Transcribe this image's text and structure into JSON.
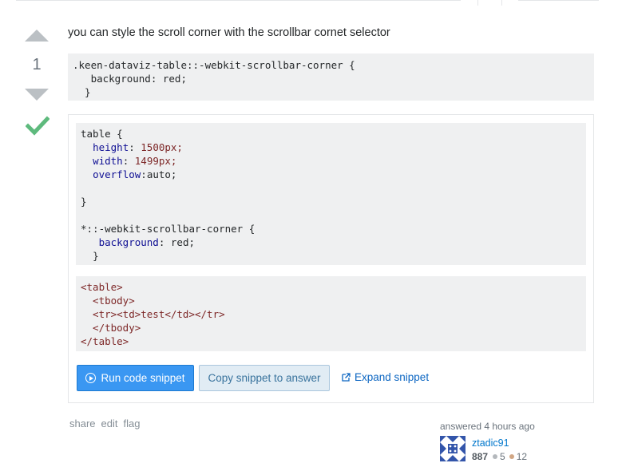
{
  "answer": {
    "vote_count": "1",
    "text": "you can style the scroll corner with the scrollbar cornet selector",
    "code1": [
      ".keen-dataviz-table::-webkit-scrollbar-corner {",
      "   background: red;",
      "  }"
    ]
  },
  "snippet": {
    "css": {
      "selector1": "table {",
      "props": [
        {
          "name": "height",
          "value": "1500px;"
        },
        {
          "name": "width",
          "value": "1499px;"
        },
        {
          "name": "overflow",
          "value": "auto;"
        }
      ],
      "close1": "}",
      "selector2": "*::-webkit-scrollbar-corner {",
      "bg_prop": "background",
      "bg_value": "red;",
      "close2": "}"
    },
    "html": [
      "<table>",
      "  <tbody>",
      "  <tr><td>test</td></tr>",
      "  </tbody>",
      "</table>"
    ],
    "run_label": "Run code snippet",
    "copy_label": "Copy snippet to answer",
    "expand_label": "Expand snippet"
  },
  "post_menu": {
    "share": "share",
    "edit": "edit",
    "flag": "flag"
  },
  "user": {
    "action": "answered 4 hours ago",
    "name": "ztadic91",
    "reputation": "887",
    "silver": "5",
    "bronze": "12"
  },
  "colors": {
    "accent": "#3a97f2",
    "accepted": "#5eba7d",
    "link": "#0c66c2"
  }
}
